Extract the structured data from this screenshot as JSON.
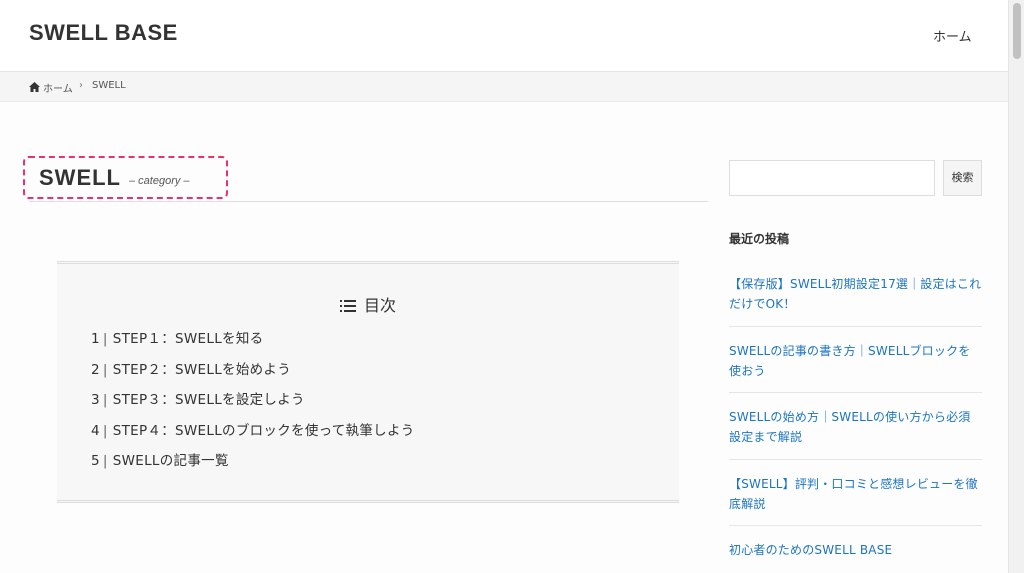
{
  "header": {
    "site_title": "SWELL BASE",
    "nav": [
      {
        "label": "ホーム"
      }
    ]
  },
  "breadcrumb": {
    "home_icon": "home-icon",
    "home_label": "ホーム",
    "separator": "›",
    "current": "SWELL"
  },
  "category": {
    "title": "SWELL",
    "subtitle": "– category –",
    "highlight_color": "#e8336a"
  },
  "toc": {
    "icon": "list-icon",
    "title": "目次",
    "items": [
      {
        "num": "1",
        "label": "STEP１：SWELLを知る"
      },
      {
        "num": "2",
        "label": "STEP２：SWELLを始めよう"
      },
      {
        "num": "3",
        "label": "STEP３：SWELLを設定しよう"
      },
      {
        "num": "4",
        "label": "STEP４：SWELLのブロックを使って執筆しよう"
      },
      {
        "num": "5",
        "label": "SWELLの記事一覧"
      }
    ]
  },
  "sidebar": {
    "search": {
      "value": "",
      "placeholder": "",
      "button_label": "検索"
    },
    "recent_title": "最近の投稿",
    "recent_posts": [
      "【保存版】SWELL初期設定17選｜設定はこれだけでOK！",
      "SWELLの記事の書き方｜SWELLブロックを使おう",
      "SWELLの始め方｜SWELLの使い方から必須設定まで解説",
      "【SWELL】評判・口コミと感想レビューを徹底解説",
      "初心者のためのSWELL BASE"
    ],
    "link_color": "#1c74c4"
  }
}
